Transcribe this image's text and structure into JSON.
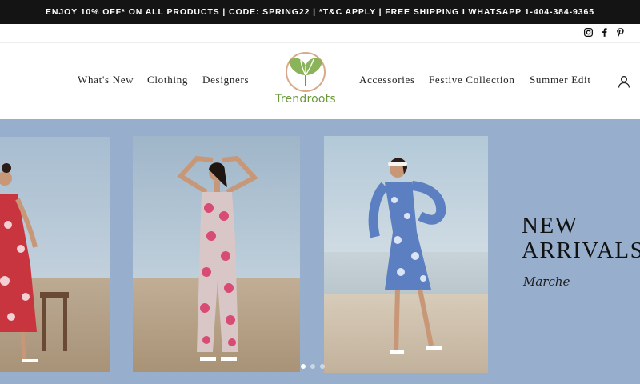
{
  "announcement": {
    "text": "ENJOY 10% OFF* ON ALL PRODUCTS | CODE: SPRING22 | *T&C APPLY | FREE SHIPPING I WHATSAPP 1-404-384-9365"
  },
  "social": {
    "icons": [
      "instagram-icon",
      "facebook-icon",
      "pinterest-icon"
    ]
  },
  "nav": {
    "left": [
      "What's New",
      "Clothing",
      "Designers"
    ],
    "right": [
      "Accessories",
      "Festive Collection",
      "Summer Edit"
    ]
  },
  "logo": {
    "text": "Trendroots",
    "color": "#6b9a3c"
  },
  "hero": {
    "background": "#97afcc",
    "headline": [
      "NEW",
      "ARRIVALS"
    ],
    "signature": "Marche",
    "slides_total": 3,
    "active_slide": 1
  }
}
